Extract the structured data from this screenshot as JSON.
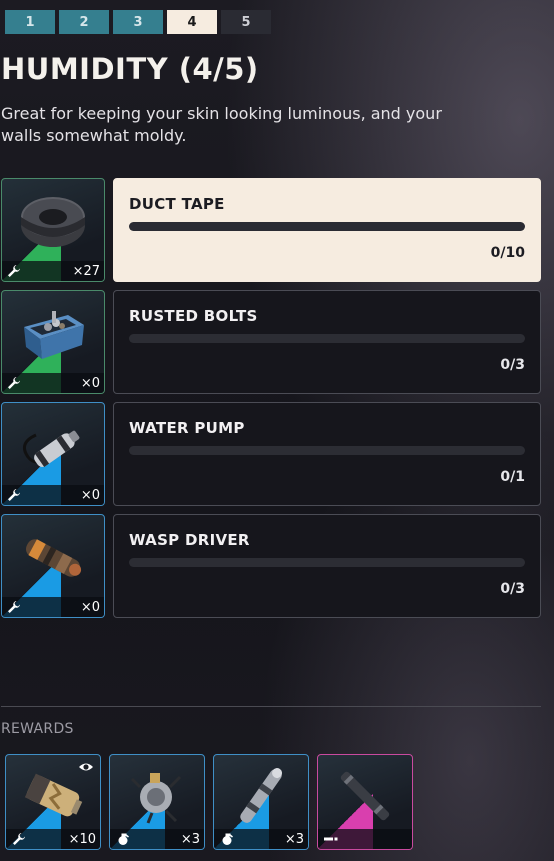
{
  "tabs": [
    {
      "label": "1",
      "state": "completed"
    },
    {
      "label": "2",
      "state": "completed"
    },
    {
      "label": "3",
      "state": "completed"
    },
    {
      "label": "4",
      "state": "active"
    },
    {
      "label": "5",
      "state": "locked"
    }
  ],
  "title": "HUMIDITY (4/5)",
  "description": "Great for keeping your skin looking luminous, and your walls somewhat moldy.",
  "requirements": [
    {
      "name": "DUCT TAPE",
      "progress": "0/10",
      "owned": "×27",
      "rarity": "uncommon",
      "icon": "duct-tape-icon"
    },
    {
      "name": "RUSTED BOLTS",
      "progress": "0/3",
      "owned": "×0",
      "rarity": "uncommon",
      "icon": "rusted-bolts-icon"
    },
    {
      "name": "WATER PUMP",
      "progress": "0/1",
      "owned": "×0",
      "rarity": "rare",
      "icon": "water-pump-icon"
    },
    {
      "name": "WASP DRIVER",
      "progress": "0/3",
      "owned": "×0",
      "rarity": "rare",
      "icon": "wasp-driver-icon"
    }
  ],
  "rewards_label": "REWARDS",
  "rewards": [
    {
      "count": "×10",
      "type": "material",
      "rarity": "rare",
      "icon": "battery-icon"
    },
    {
      "count": "×3",
      "type": "grenade",
      "rarity": "rare",
      "icon": "gadget-icon"
    },
    {
      "count": "×3",
      "type": "grenade",
      "rarity": "rare",
      "icon": "canister-icon"
    },
    {
      "count": "",
      "type": "attachment",
      "rarity": "epic",
      "icon": "silencer-icon"
    }
  ],
  "colors": {
    "tab_completed": "#357f8f",
    "tab_active": "#f6ece0",
    "uncommon": "#2fb15a",
    "rare": "#1a9be4",
    "epic": "#d93fae"
  }
}
